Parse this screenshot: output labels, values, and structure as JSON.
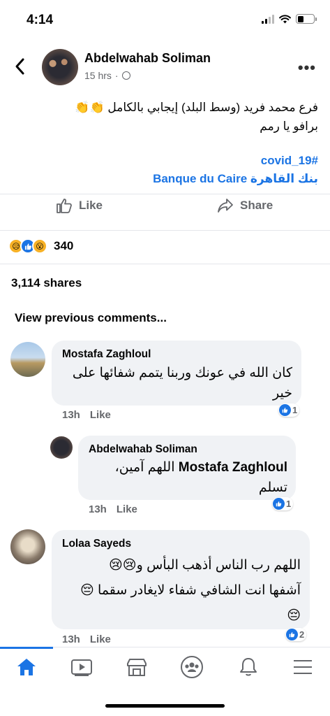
{
  "status": {
    "time": "4:14"
  },
  "post": {
    "author": "Abdelwahab Soliman",
    "time": "15 hrs",
    "text_line1": "فرع محمد فريد (وسط البلد) إيجابي بالكامل 👏👏",
    "text_line2": "برافو يا رمم",
    "hashtag": "#covid_19",
    "tag_line": "بنك القاهرة Banque du Caire",
    "like_label": "Like",
    "share_label": "Share",
    "reaction_count": "340",
    "shares": "3,114 shares",
    "view_previous": "View previous comments..."
  },
  "comments": [
    {
      "name": "Mostafa Zaghloul",
      "text": "كان الله في عونك وربنا يتمم شفائها على خير",
      "time": "13h",
      "like_label": "Like",
      "reactions": "1"
    },
    {
      "name": "Abdelwahab Soliman",
      "mention": "Mostafa Zaghloul",
      "text": "اللهم آمين، تسلم",
      "time": "13h",
      "like_label": "Like",
      "reactions": "1"
    },
    {
      "name": "Lolaa Sayeds",
      "text_line1": "اللهم رب الناس أذهب البأس و😢😢",
      "text_line2": "آشفها انت الشافي شفاء لايغادر سقما 😔",
      "text_line3": "😔",
      "time": "13h",
      "like_label": "Like",
      "reactions": "2"
    }
  ],
  "tabbar": {
    "items": [
      "home-icon",
      "video-icon",
      "marketplace-icon",
      "groups-icon",
      "notifications-icon",
      "menu-icon"
    ],
    "active": "home-icon"
  },
  "colors": {
    "accent": "#1b74e4",
    "muted": "#65676b",
    "bubble": "#f0f2f5"
  }
}
